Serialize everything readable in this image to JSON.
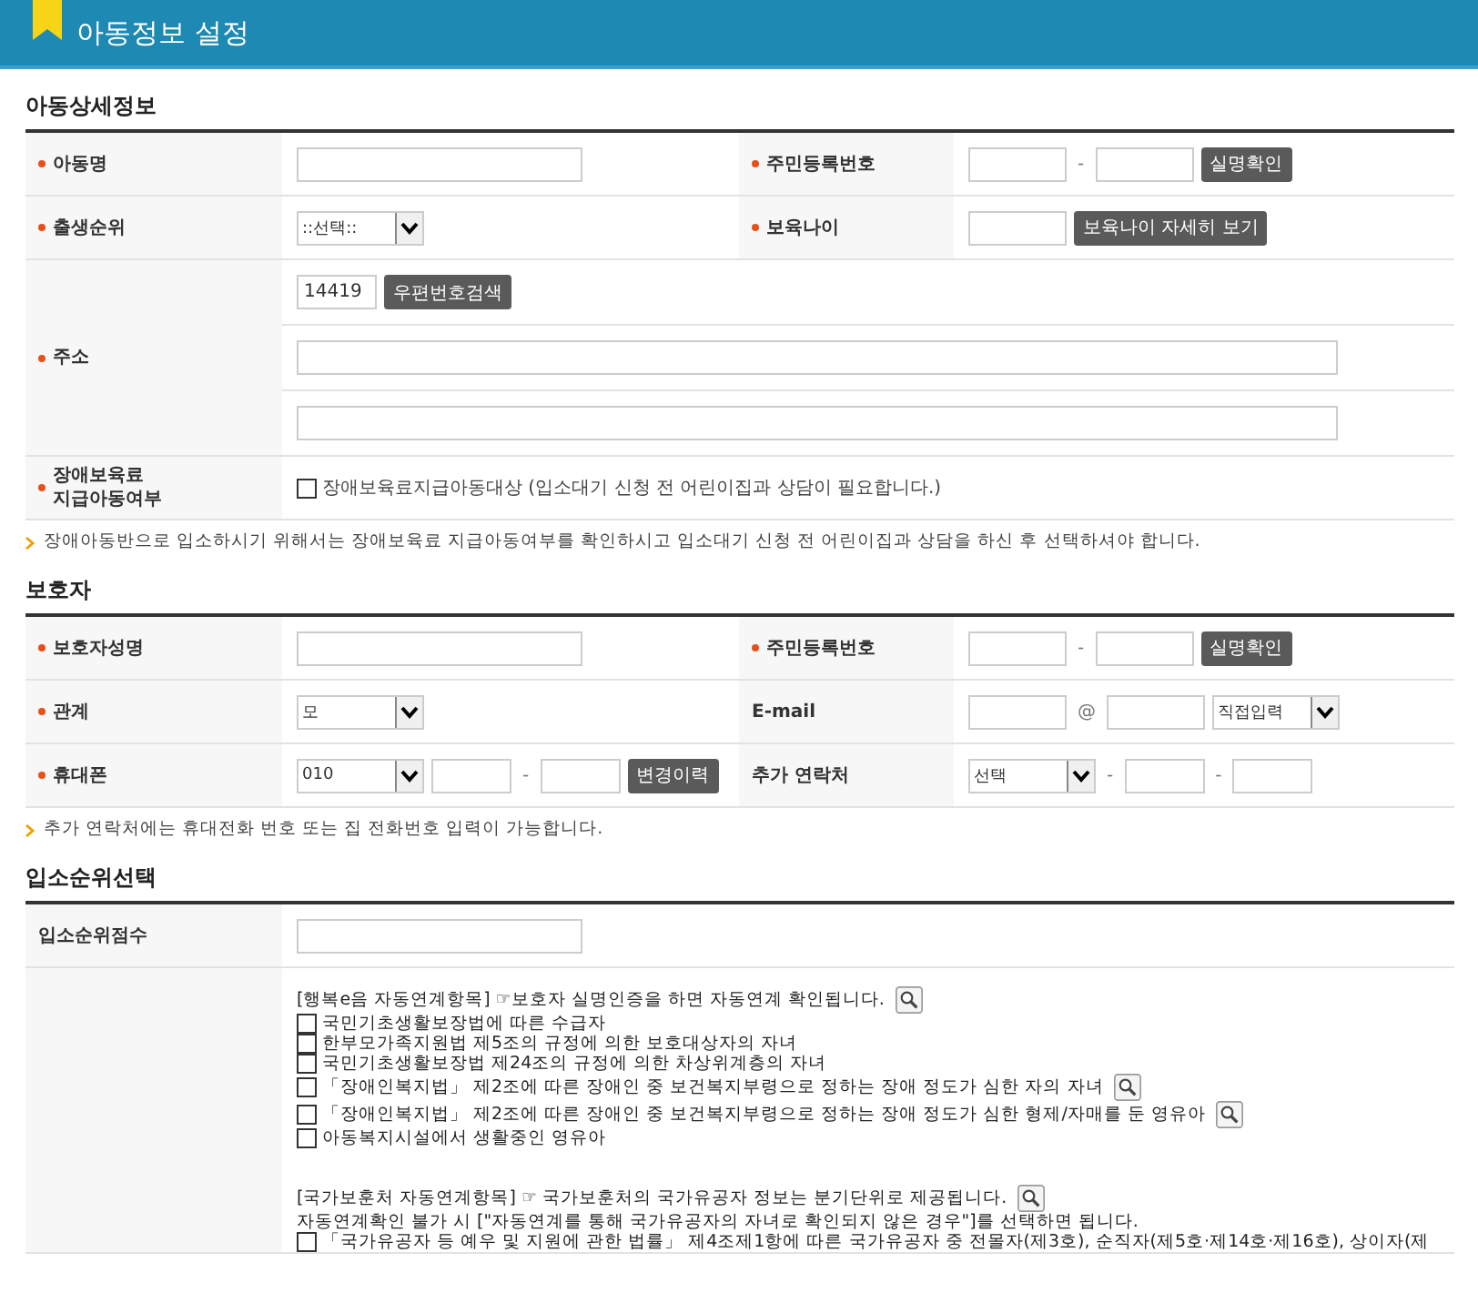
{
  "header": {
    "title": "아동정보 설정"
  },
  "sections": [
    {
      "title": "아동상세정보",
      "rows": [
        {
          "cells": [
            {
              "label": "아동명",
              "required": true,
              "fields": [
                {
                  "kind": "text"
                }
              ]
            },
            {
              "label": "주민등록번호",
              "required": true,
              "fields": [
                {
                  "kind": "text"
                },
                {
                  "kind": "sep",
                  "text": "-"
                },
                {
                  "kind": "text"
                },
                {
                  "kind": "button",
                  "text": "실명확인"
                }
              ]
            }
          ]
        },
        {
          "cells": [
            {
              "label": "출생순위",
              "required": true,
              "fields": [
                {
                  "kind": "select",
                  "value": "::선택::"
                }
              ]
            },
            {
              "label": "보육나이",
              "required": true,
              "fields": [
                {
                  "kind": "text"
                },
                {
                  "kind": "button",
                  "text": "보육나이 자세히 보기"
                }
              ]
            }
          ]
        },
        {
          "cells": [
            {
              "label": "주소",
              "required": true,
              "lines": [
                [
                  {
                    "kind": "text",
                    "value": "14419"
                  },
                  {
                    "kind": "button",
                    "text": "우편번호검색"
                  }
                ],
                [
                  {
                    "kind": "text"
                  }
                ],
                [
                  {
                    "kind": "text"
                  }
                ]
              ]
            }
          ]
        },
        {
          "cells": [
            {
              "label": "장애보육료\n지급아동여부",
              "required": true,
              "fields": [
                {
                  "kind": "checkbox",
                  "checked": false,
                  "text": "장애보육료지급아동대상 (입소대기 신청 전 어린이집과 상담이 필요합니다.)"
                }
              ]
            }
          ]
        }
      ],
      "note": "장애아동반으로 입소하시기 위해서는 장애보육료 지급아동여부를 확인하시고 입소대기 신청 전 어린이집과 상담을 하신 후 선택하셔야 합니다."
    },
    {
      "title": "보호자",
      "rows": [
        {
          "cells": [
            {
              "label": "보호자성명",
              "required": true,
              "fields": [
                {
                  "kind": "text"
                }
              ]
            },
            {
              "label": "주민등록번호",
              "required": true,
              "fields": [
                {
                  "kind": "text"
                },
                {
                  "kind": "sep",
                  "text": "-"
                },
                {
                  "kind": "text"
                },
                {
                  "kind": "button",
                  "text": "실명확인"
                }
              ]
            }
          ]
        },
        {
          "cells": [
            {
              "label": "관계",
              "required": true,
              "fields": [
                {
                  "kind": "select",
                  "value": "모"
                }
              ]
            },
            {
              "label": "E-mail",
              "required": false,
              "fields": [
                {
                  "kind": "text"
                },
                {
                  "kind": "sep",
                  "text": "@"
                },
                {
                  "kind": "text"
                },
                {
                  "kind": "select",
                  "value": "직접입력"
                }
              ]
            }
          ]
        },
        {
          "cells": [
            {
              "label": "휴대폰",
              "required": true,
              "fields": [
                {
                  "kind": "select",
                  "value": "010"
                },
                {
                  "kind": "text"
                },
                {
                  "kind": "sep",
                  "text": "-"
                },
                {
                  "kind": "text"
                },
                {
                  "kind": "button",
                  "text": "변경이력"
                }
              ]
            },
            {
              "label": "추가 연락처",
              "required": false,
              "fields": [
                {
                  "kind": "select",
                  "value": "선택"
                },
                {
                  "kind": "sep",
                  "text": "-"
                },
                {
                  "kind": "text"
                },
                {
                  "kind": "sep",
                  "text": "-"
                },
                {
                  "kind": "text"
                }
              ]
            }
          ]
        }
      ],
      "note": "추가 연락처에는 휴대전화 번호 또는 집 전화번호 입력이 가능합니다."
    },
    {
      "title": "입소순위선택",
      "rows": [
        {
          "cells": [
            {
              "label": "입소순위점수",
              "required": false,
              "fields": [
                {
                  "kind": "text"
                }
              ]
            }
          ]
        },
        {
          "cells": [
            {
              "items": [
                {
                  "kind": "info",
                  "text": "[행복e음 자동연계항목] ☞보호자 실명인증을 하면 자동연계 확인됩니다.",
                  "lookup": true
                },
                {
                  "kind": "check",
                  "text": "국민기초생활보장법에 따른 수급자",
                  "checked": false,
                  "lookup": false
                },
                {
                  "kind": "check",
                  "text": "한부모가족지원법 제5조의 규정에 의한 보호대상자의 자녀",
                  "checked": false,
                  "lookup": false
                },
                {
                  "kind": "check",
                  "text": "국민기초생활보장법 제24조의 규정에 의한 차상위계층의 자녀",
                  "checked": false,
                  "lookup": false
                },
                {
                  "kind": "check",
                  "text": "「장애인복지법」 제2조에 따른 장애인 중 보건복지부령으로 정하는 장애 정도가 심한 자의 자녀",
                  "checked": false,
                  "lookup": true
                },
                {
                  "kind": "check",
                  "text": "「장애인복지법」 제2조에 따른 장애인 중 보건복지부령으로 정하는 장애 정도가 심한 형제/자매를 둔 영유아",
                  "checked": false,
                  "lookup": true
                },
                {
                  "kind": "check",
                  "text": "아동복지시설에서 생활중인 영유아",
                  "checked": false,
                  "lookup": false
                },
                {
                  "kind": "gap"
                },
                {
                  "kind": "info",
                  "text": "[국가보훈처 자동연계항목] ☞ 국가보훈처의 국가유공자 정보는 분기단위로 제공됩니다.",
                  "lookup": true
                },
                {
                  "kind": "plain",
                  "text": "자동연계확인 불가 시 [\"자동연계를 통해 국가유공자의 자녀로 확인되지 않은 경우\"]를 선택하면 됩니다."
                },
                {
                  "kind": "check",
                  "text": "「국가유공자 등 예우 및 지원에 관한 법률」 제4조제1항에 따른 국가유공자 중 전몰자(제3호), 순직자(제5호·제14호·제16호), 상이자(제",
                  "checked": false
                }
              ]
            }
          ]
        }
      ]
    }
  ]
}
